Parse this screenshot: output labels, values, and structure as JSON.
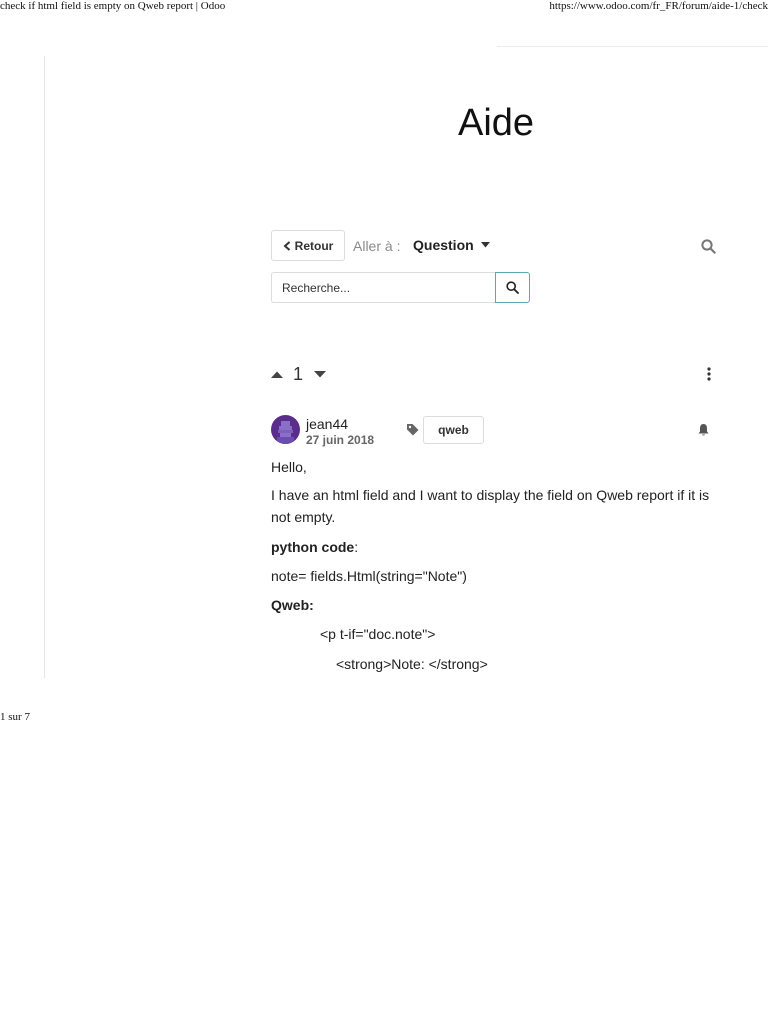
{
  "print": {
    "title": "check if html field is empty on Qweb report | Odoo",
    "url": "https://www.odoo.com/fr_FR/forum/aide-1/check",
    "page": "1 sur 7"
  },
  "forum": {
    "heading": "Aide"
  },
  "toolbar": {
    "back_label": "Retour",
    "goto_label": "Aller à :",
    "goto_value": "Question"
  },
  "search": {
    "placeholder": "Recherche..."
  },
  "question": {
    "votes": "1",
    "author": "jean44",
    "date": "27 juin 2018",
    "tag": "qweb",
    "body": {
      "greeting": "Hello,",
      "intro": "I have an html field and I want to display the field on Qweb report if it is not empty.",
      "python_label": "python code",
      "python_suffix": ":",
      "python_code": "note= fields.Html(string=\"Note\")",
      "qweb_label": "Qweb:",
      "code_line_1": "<p t-if=\"doc.note\">",
      "code_line_2": "<strong>Note: </strong>"
    }
  },
  "icons": {
    "back": "chevron-left-icon",
    "goto": "caret-down-icon",
    "search": "search-icon",
    "vote_up": "caret-up-icon",
    "vote_down": "caret-down-icon",
    "menu": "kebab-menu-icon",
    "tag": "tag-icon",
    "follow": "bell-icon"
  },
  "colors": {
    "search_button_border": "#5ba7b5",
    "avatar_bg": "#5a2d8c",
    "text": "#222222",
    "muted": "#8a8a8a"
  }
}
